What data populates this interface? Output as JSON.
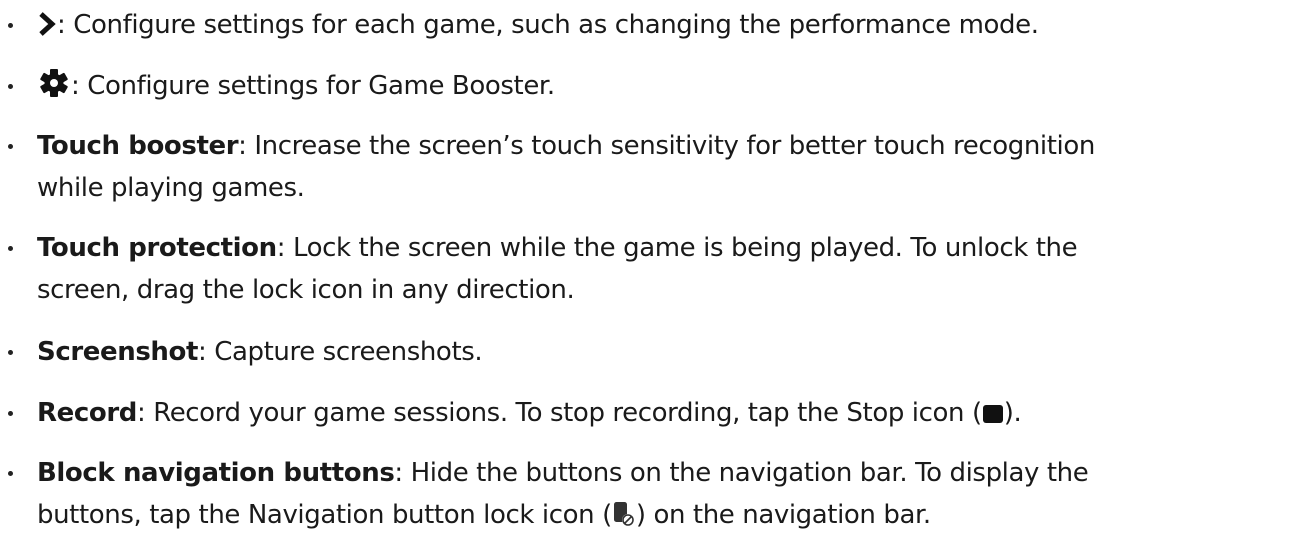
{
  "items": [
    {
      "icon": "chevron-right-icon",
      "line1": ": Configure settings for each game, such as changing the performance mode."
    },
    {
      "icon": "gear-icon",
      "line1": ": Configure settings for Game Booster."
    },
    {
      "term": "Touch booster",
      "line1": ": Increase the screen’s touch sensitivity for better touch recognition",
      "line2": "while playing games."
    },
    {
      "term": "Touch protection",
      "line1": ": Lock the screen while the game is being played. To unlock the",
      "line2": "screen, drag the lock icon in any direction."
    },
    {
      "term": "Screenshot",
      "line1": ": Capture screenshots."
    },
    {
      "term": "Record",
      "line1": ": Record your game sessions. To stop recording, tap the Stop icon (",
      "icon": "stop-icon",
      "line1_end": ")."
    },
    {
      "term": "Block navigation buttons",
      "line1": ": Hide the buttons on the navigation bar. To display the",
      "line2": "buttons, tap the Navigation button lock icon (",
      "icon": "navigation-button-lock-icon",
      "line2_end": ") on the navigation bar."
    }
  ]
}
